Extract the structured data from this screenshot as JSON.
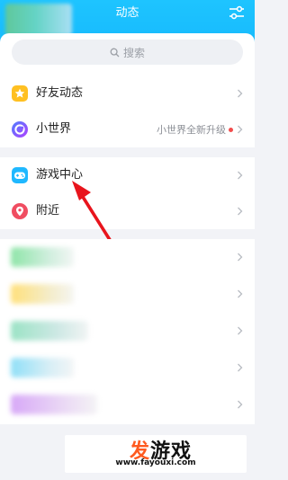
{
  "header": {
    "title": "动态"
  },
  "search": {
    "placeholder": "搜索"
  },
  "rows": [
    {
      "label": "好友动态",
      "icon": "star-icon"
    },
    {
      "label": "小世界",
      "icon": "world-icon",
      "badge_text": "小世界全新升级"
    },
    {
      "label": "游戏中心",
      "icon": "gamepad-icon"
    },
    {
      "label": "附近",
      "icon": "location-icon"
    }
  ],
  "watermark": {
    "brand_prefix": "发",
    "brand_suffix": "游戏",
    "url": "www.fayouxi.com"
  },
  "colors": {
    "accent": "#12b4fb",
    "star": "#ffc022",
    "world": "#6b4dff",
    "game": "#1fb8ff",
    "location": "#f04d61",
    "dot": "#f24c4c"
  }
}
